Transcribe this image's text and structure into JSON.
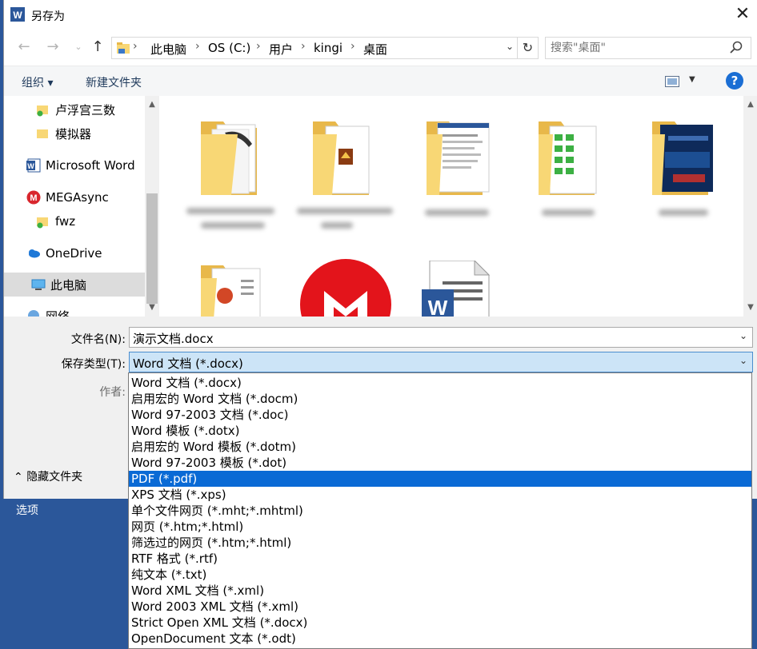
{
  "word": {
    "options_label": "选项"
  },
  "dialog": {
    "title": "另存为",
    "close_label": "✕",
    "address": {
      "crumbs": [
        "此电脑",
        "OS (C:)",
        "用户",
        "kingi",
        "桌面"
      ]
    },
    "search": {
      "placeholder": "搜索\"桌面\""
    },
    "toolbar": {
      "organize_label": "组织 ▾",
      "new_folder_label": "新建文件夹",
      "help_label": "?"
    },
    "nav_items": [
      {
        "label": "卢浮宫三数",
        "icon": "folder-icon"
      },
      {
        "label": "模拟器",
        "icon": "folder-icon"
      },
      {
        "label": "Microsoft Word",
        "icon": "word-icon"
      },
      {
        "label": "MEGAsync",
        "icon": "mega-icon"
      },
      {
        "label": "fwz",
        "icon": "folder-icon"
      },
      {
        "label": "OneDrive",
        "icon": "cloud-icon"
      },
      {
        "label": "此电脑",
        "icon": "computer-icon"
      },
      {
        "label": "网络",
        "icon": "network-icon"
      }
    ],
    "filename_label": "文件名(N):",
    "filename_value": "演示文档.docx",
    "filetype_label": "保存类型(T):",
    "filetype_value": "Word 文档 (*.docx)",
    "author_label": "作者:",
    "hide_folders_label": "隐藏文件夹",
    "filetype_options": [
      "Word 文档 (*.docx)",
      "启用宏的 Word 文档 (*.docm)",
      "Word 97-2003 文档 (*.doc)",
      "Word 模板 (*.dotx)",
      "启用宏的 Word 模板 (*.dotm)",
      "Word 97-2003 模板 (*.dot)",
      "PDF (*.pdf)",
      "XPS 文档 (*.xps)",
      "单个文件网页 (*.mht;*.mhtml)",
      "网页 (*.htm;*.html)",
      "筛选过的网页 (*.htm;*.html)",
      "RTF 格式 (*.rtf)",
      "纯文本 (*.txt)",
      "Word XML 文档 (*.xml)",
      "Word 2003 XML 文档 (*.xml)",
      "Strict Open XML 文档 (*.docx)",
      "OpenDocument 文本 (*.odt)"
    ],
    "selected_option": "PDF (*.pdf)"
  },
  "colors": {
    "word_blue": "#2b579a",
    "selection": "#0a6ad5",
    "field_active": "#cce4f7"
  }
}
